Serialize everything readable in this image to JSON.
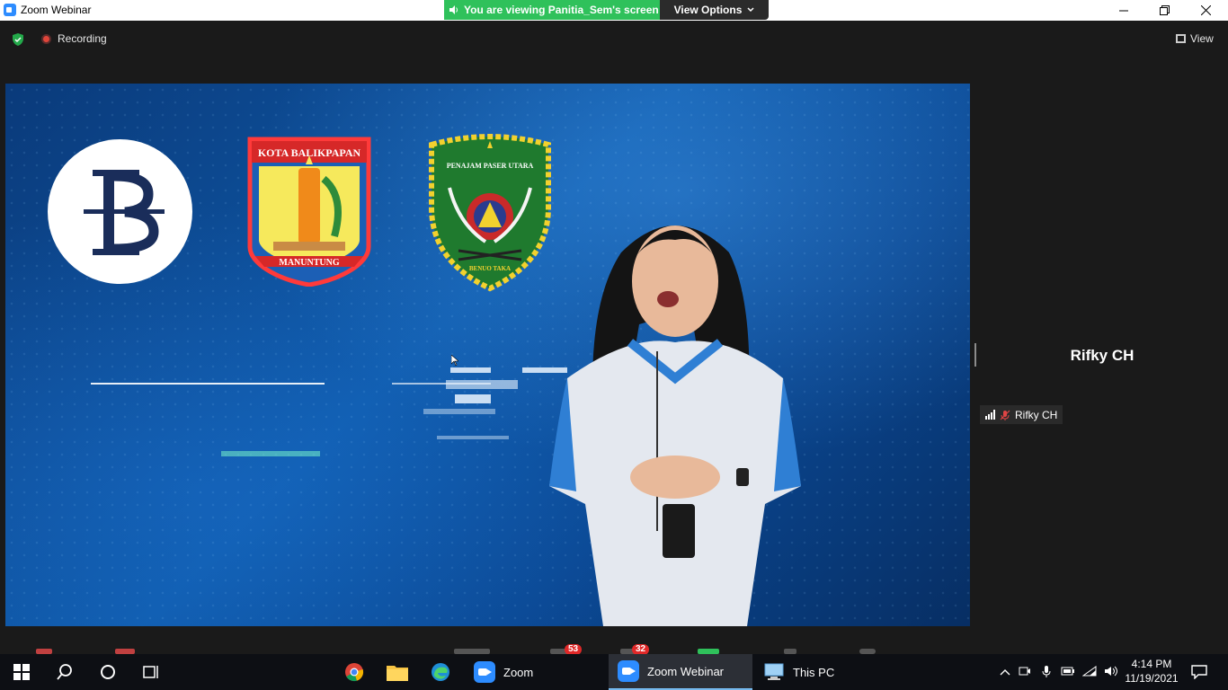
{
  "window": {
    "title": "Zoom Webinar",
    "share_banner": "You are viewing Panitia_Sem's screen",
    "view_options": "View Options",
    "minimize_icon": "minimize-icon",
    "restore_icon": "restore-icon",
    "close_icon": "close-icon"
  },
  "meeting_bar": {
    "recording_label": "Recording",
    "view_label": "View",
    "accent": "#2fc15b",
    "record_color": "#e0453a"
  },
  "shared_screen": {
    "logos": [
      "bank-indonesia-logo",
      "kota-balikpapan-emblem",
      "penajam-paser-utara-emblem"
    ],
    "balikpapan_top": "KOTA BALIKPAPAN",
    "balikpapan_bottom": "MANUNTUNG",
    "ppu_top": "PENAJAM PASER UTARA",
    "ppu_bottom": "BENUO TAKA"
  },
  "side_panel": {
    "speaker_name": "Rifky CH",
    "participant_tag": "Rifky CH"
  },
  "zoom_toolbar": {
    "chat_badge": "53",
    "qa_badge": "32"
  },
  "taskbar": {
    "apps": [
      {
        "label": "Zoom",
        "icon": "zoom-icon"
      },
      {
        "label": "Zoom Webinar",
        "icon": "zoom-icon"
      },
      {
        "label": "This PC",
        "icon": "this-pc-icon"
      }
    ],
    "time": "4:14 PM",
    "date": "11/19/2021"
  }
}
